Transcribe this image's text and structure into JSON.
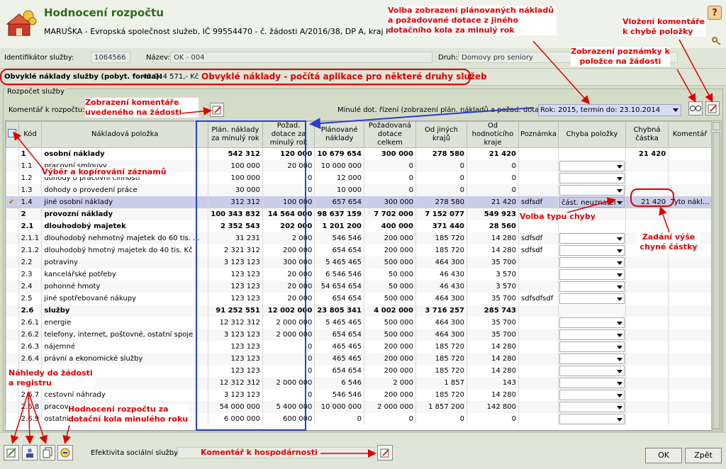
{
  "header": {
    "title": "Hodnocení rozpočtu",
    "subtitle": "MARUŠKA - Evropská společnost služeb, IČ 99554470 - č. žádosti A/2016/38, DP A, kraj Hlavní"
  },
  "service": {
    "id_label": "Identifikátor služby:",
    "id_value": "1064566",
    "name_label": "Název:",
    "name_value": "OK - 004",
    "type_label": "Druh:",
    "type_value": "Domovy pro seniory"
  },
  "costs": {
    "label": "Obvyklé náklady služby (pobyt. forma):",
    "value": "42 944 571,- Kč"
  },
  "budget": {
    "group_title": "Rozpočet služby",
    "comment_label": "Komentář k rozpočtu:",
    "prev_label": "Minulé dot. řízení (zobrazení plán. nákladů a požad. dotace):",
    "prev_value": "Rok: 2015, termín do: 23.10.2014"
  },
  "columns": [
    "",
    "Kód",
    "Nákladová položka",
    "Plán. náklady za minulý rok",
    "Požad. dotace za minulý rok",
    "Plánované náklady",
    "Požadovaná dotace celkem",
    "Od jiných krajů",
    "Od hodnotícího kraje",
    "Poznámka",
    "Chyba položky",
    "Chybná částka",
    "Komentář"
  ],
  "rows": [
    {
      "code": "1",
      "name": "osobní náklady",
      "plan": "542 312",
      "pozad": "120 000",
      "planov": "10 679 654",
      "celkem": "300 000",
      "jiny": "278 580",
      "kraj": "21 420",
      "pozn": "",
      "chyba": "",
      "dd": false,
      "castka": "21 420",
      "kom": "",
      "bold": true,
      "sel": false
    },
    {
      "code": "1.1",
      "name": "pracovní smlouvy",
      "plan": "100 000",
      "pozad": "20 000",
      "planov": "10 000 000",
      "celkem": "0",
      "jiny": "0",
      "kraj": "0",
      "pozn": "",
      "chyba": "",
      "dd": true,
      "castka": "",
      "kom": "",
      "bold": false,
      "sel": false
    },
    {
      "code": "1.2",
      "name": "dohody o pracovní činnosti",
      "plan": "100 000",
      "pozad": "0",
      "planov": "12 000",
      "celkem": "0",
      "jiny": "0",
      "kraj": "0",
      "pozn": "",
      "chyba": "",
      "dd": true,
      "castka": "",
      "kom": "",
      "bold": false,
      "sel": false
    },
    {
      "code": "1.3",
      "name": "dohody o provedení práce",
      "plan": "30 000",
      "pozad": "0",
      "planov": "10 000",
      "celkem": "0",
      "jiny": "0",
      "kraj": "0",
      "pozn": "",
      "chyba": "",
      "dd": true,
      "castka": "",
      "kom": "",
      "bold": false,
      "sel": false
    },
    {
      "code": "1.4",
      "name": "jiné osobní náklady",
      "plan": "312 312",
      "pozad": "100 000",
      "planov": "657 654",
      "celkem": "300 000",
      "jiny": "278 580",
      "kraj": "21 420",
      "pozn": "sdfsdf",
      "chyba": "část. neuznatel",
      "dd": true,
      "castka": "21 420",
      "kom": "Tyto nákl...",
      "bold": false,
      "sel": true
    },
    {
      "code": "2",
      "name": "provozní náklady",
      "plan": "100 343 832",
      "pozad": "14 564 000",
      "planov": "98 637 159",
      "celkem": "7 702 000",
      "jiny": "7 152 077",
      "kraj": "549 923",
      "pozn": "",
      "chyba": "",
      "dd": false,
      "castka": "",
      "kom": "",
      "bold": true,
      "sel": false
    },
    {
      "code": "2.1",
      "name": "dlouhodobý majetek",
      "plan": "2 352 543",
      "pozad": "202 000",
      "planov": "1 201 200",
      "celkem": "400 000",
      "jiny": "371 440",
      "kraj": "28 560",
      "pozn": "",
      "chyba": "",
      "dd": false,
      "castka": "",
      "kom": "",
      "bold": true,
      "sel": false
    },
    {
      "code": "2.1.1",
      "name": "dlouhodobý nehmotný majetek do 60 tis. ...",
      "plan": "31 231",
      "pozad": "2 000",
      "planov": "546 546",
      "celkem": "200 000",
      "jiny": "185 720",
      "kraj": "14 280",
      "pozn": "sdfsdf",
      "chyba": "",
      "dd": true,
      "castka": "",
      "kom": "",
      "bold": false,
      "sel": false
    },
    {
      "code": "2.1.2",
      "name": "dlouhodobý hmotný majetek do 40 tis. Kč",
      "plan": "2 321 312",
      "pozad": "200 000",
      "planov": "654 654",
      "celkem": "200 000",
      "jiny": "185 720",
      "kraj": "14 280",
      "pozn": "sdfsdf",
      "chyba": "",
      "dd": true,
      "castka": "",
      "kom": "",
      "bold": false,
      "sel": false
    },
    {
      "code": "2.2",
      "name": "potraviny",
      "plan": "3 123 123",
      "pozad": "300 000",
      "planov": "5 465 465",
      "celkem": "500 000",
      "jiny": "464 300",
      "kraj": "35 700",
      "pozn": "",
      "chyba": "",
      "dd": true,
      "castka": "",
      "kom": "",
      "bold": false,
      "sel": false
    },
    {
      "code": "2.3",
      "name": "kancelářské potřeby",
      "plan": "123 123",
      "pozad": "20 000",
      "planov": "6 546 546",
      "celkem": "50 000",
      "jiny": "46 430",
      "kraj": "3 570",
      "pozn": "",
      "chyba": "",
      "dd": true,
      "castka": "",
      "kom": "",
      "bold": false,
      "sel": false
    },
    {
      "code": "2.4",
      "name": "pohonné hmoty",
      "plan": "123 123",
      "pozad": "20 000",
      "planov": "54 654 654",
      "celkem": "50 000",
      "jiny": "46 430",
      "kraj": "3 570",
      "pozn": "",
      "chyba": "",
      "dd": true,
      "castka": "",
      "kom": "",
      "bold": false,
      "sel": false
    },
    {
      "code": "2.5",
      "name": "jiné spotřebované nákupy",
      "plan": "123 123",
      "pozad": "20 000",
      "planov": "654 654",
      "celkem": "500 000",
      "jiny": "464 300",
      "kraj": "35 700",
      "pozn": "sdfsdfsdf",
      "chyba": "",
      "dd": true,
      "castka": "",
      "kom": "",
      "bold": false,
      "sel": false
    },
    {
      "code": "2.6",
      "name": "služby",
      "plan": "91 252 551",
      "pozad": "12 002 000",
      "planov": "23 805 341",
      "celkem": "4 002 000",
      "jiny": "3 716 257",
      "kraj": "285 743",
      "pozn": "",
      "chyba": "",
      "dd": false,
      "castka": "",
      "kom": "",
      "bold": true,
      "sel": false
    },
    {
      "code": "2.6.1",
      "name": "energie",
      "plan": "12 312 312",
      "pozad": "2 000 000",
      "planov": "5 465 465",
      "celkem": "500 000",
      "jiny": "464 300",
      "kraj": "35 700",
      "pozn": "",
      "chyba": "",
      "dd": true,
      "castka": "",
      "kom": "",
      "bold": false,
      "sel": false
    },
    {
      "code": "2.6.2",
      "name": "telefony, internet, poštovné, ostatní spoje",
      "plan": "3 123 123",
      "pozad": "2 000 000",
      "planov": "654 654",
      "celkem": "500 000",
      "jiny": "464 300",
      "kraj": "35 700",
      "pozn": "",
      "chyba": "",
      "dd": true,
      "castka": "",
      "kom": "",
      "bold": false,
      "sel": false
    },
    {
      "code": "2.6.3",
      "name": "nájemné",
      "plan": "123 123",
      "pozad": "0",
      "planov": "465 465",
      "celkem": "200 000",
      "jiny": "185 720",
      "kraj": "14 280",
      "pozn": "",
      "chyba": "",
      "dd": true,
      "castka": "",
      "kom": "",
      "bold": false,
      "sel": false
    },
    {
      "code": "2.6.4",
      "name": "právní a ekonomické služby",
      "plan": "123 123",
      "pozad": "0",
      "planov": "465 465",
      "celkem": "200 000",
      "jiny": "185 720",
      "kraj": "14 280",
      "pozn": "",
      "chyba": "",
      "dd": true,
      "castka": "",
      "kom": "",
      "bold": false,
      "sel": false
    },
    {
      "code": "",
      "name": "",
      "plan": "123 123",
      "pozad": "0",
      "planov": "654 654",
      "celkem": "200 000",
      "jiny": "185 720",
      "kraj": "14 280",
      "pozn": "",
      "chyba": "",
      "dd": true,
      "castka": "",
      "kom": "",
      "bold": false,
      "sel": false
    },
    {
      "code": "",
      "name": "ání",
      "plan": "12 312 312",
      "pozad": "2 000 000",
      "planov": "6 546",
      "celkem": "2 000",
      "jiny": "1 857",
      "kraj": "143",
      "pozn": "",
      "chyba": "",
      "dd": true,
      "castka": "",
      "kom": "",
      "bold": false,
      "sel": false
    },
    {
      "code": "2.6.7",
      "name": "cestovní náhrady",
      "plan": "3 123 123",
      "pozad": "0",
      "planov": "546 546",
      "celkem": "200 000",
      "jiny": "185 720",
      "kraj": "14 280",
      "pozn": "",
      "chyba": "",
      "dd": true,
      "castka": "",
      "kom": "",
      "bold": false,
      "sel": false
    },
    {
      "code": "2.6.8",
      "name": "pracov",
      "plan": "54 000 000",
      "pozad": "5 400 000",
      "planov": "10 000 000",
      "celkem": "2 000 000",
      "jiny": "1 857 200",
      "kraj": "142 800",
      "pozn": "",
      "chyba": "",
      "dd": true,
      "castka": "",
      "kom": "",
      "bold": false,
      "sel": false
    },
    {
      "code": "2.6.9",
      "name": "ostatní",
      "plan": "6 000 000",
      "pozad": "600 000",
      "planov": "0",
      "celkem": "0",
      "jiny": "0",
      "kraj": "0",
      "pozn": "",
      "chyba": "",
      "dd": true,
      "castka": "",
      "kom": "",
      "bold": false,
      "sel": false
    }
  ],
  "bottom": {
    "efficiency_label": "Efektivita sociální služby:",
    "ok_label": "OK",
    "back_label": "Zpět"
  },
  "annotations": {
    "volba": "Volba zobrazení plánovaných nákladů a požadované dotace z jiného dotačního kola za minulý rok",
    "vlozeni": "Vložení komentáře k chybě položky",
    "poznamka": "Zobrazení poznámky k položce na žádosti",
    "obvykle": "Obvyklé náklady - počítá aplikace pro některé druhy služeb",
    "komentar_zadost": "Zobrazení komentáře uvedeného na žádosti",
    "vyber": "Výběr a kopírování záznamů",
    "typ_chyby": "Volba typu chyby",
    "zadani": "Zadání výše chyné částky",
    "nahledy": "Náhledy do žádosti a registru",
    "hodnoceni": "Hodnocení rozpočtu za dotační kola minulého roku",
    "hospodarnost": "Komentář k hospodárnosti"
  },
  "colors": {
    "title": "#2e6a1e",
    "annotation": "#e00000",
    "highlight": "#2a3fd0",
    "selected_row": "#c9cde8"
  }
}
